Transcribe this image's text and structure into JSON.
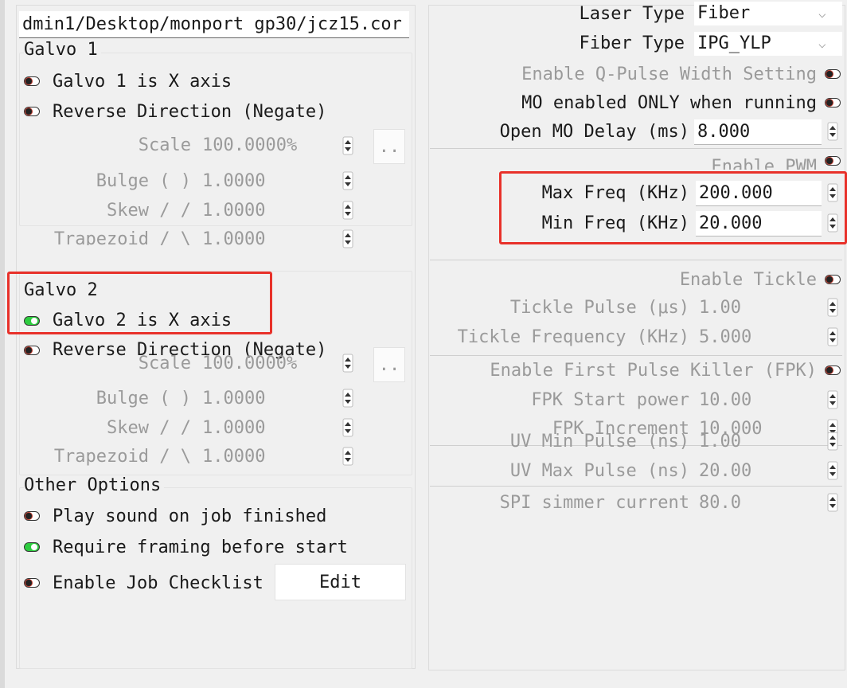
{
  "path_field": {
    "value": "dmin1/Desktop/monport gp30/jcz15.cor"
  },
  "galvo1": {
    "title": "Galvo 1",
    "x_axis": {
      "label": "Galvo 1 is X axis",
      "state": "off"
    },
    "reverse": {
      "label": "Reverse Direction (Negate)",
      "state": "off"
    },
    "scale": {
      "label": "Scale",
      "value": "100.0000%",
      "button": ".."
    },
    "bulge": {
      "label": "Bulge ( )",
      "value": "1.0000"
    },
    "skew": {
      "label": "Skew / /",
      "value": "1.0000"
    },
    "trapezoid": {
      "label": "Trapezoid / \\",
      "value": "1.0000"
    }
  },
  "galvo2": {
    "title": "Galvo 2",
    "x_axis": {
      "label": "Galvo 2 is X axis",
      "state": "on"
    },
    "reverse": {
      "label": "Reverse Direction (Negate)",
      "state": "off"
    },
    "scale": {
      "label": "Scale",
      "value": "100.0000%",
      "button": ".."
    },
    "bulge": {
      "label": "Bulge ( )",
      "value": "1.0000"
    },
    "skew": {
      "label": "Skew / /",
      "value": "1.0000"
    },
    "trapezoid": {
      "label": "Trapezoid / \\",
      "value": "1.0000"
    }
  },
  "other": {
    "title": "Other Options",
    "play_sound": {
      "label": "Play sound on job finished",
      "state": "off"
    },
    "require_framing": {
      "label": "Require framing before start",
      "state": "on"
    },
    "job_checklist": {
      "label": "Enable Job Checklist",
      "state": "off"
    },
    "edit_button": "Edit"
  },
  "laser": {
    "laser_type": {
      "label": "Laser Type",
      "value": "Fiber"
    },
    "fiber_type": {
      "label": "Fiber Type",
      "value": "IPG_YLP"
    },
    "q_pulse": {
      "label": "Enable Q-Pulse Width Setting",
      "state": "off"
    },
    "mo_running": {
      "label": "MO enabled ONLY when running",
      "state": "off"
    },
    "mo_delay": {
      "label": "Open MO Delay (ms)",
      "value": "8.000"
    },
    "pwm": {
      "label": "Enable PWM",
      "state": "off"
    },
    "max_freq": {
      "label": "Max Freq (KHz)",
      "value": "200.000"
    },
    "min_freq": {
      "label": "Min Freq (KHz)",
      "value": "20.000"
    },
    "tickle": {
      "label": "Enable Tickle",
      "state": "off"
    },
    "tickle_pulse": {
      "label": "Tickle Pulse (μs)",
      "value": "1.00"
    },
    "tickle_freq": {
      "label": "Tickle Frequency (KHz)",
      "value": "5.000"
    },
    "fpk": {
      "label": "Enable First Pulse Killer (FPK)",
      "state": "off"
    },
    "fpk_start": {
      "label": "FPK Start power",
      "value": "10.00"
    },
    "fpk_inc": {
      "label": "FPK Increment",
      "value": "10.000"
    },
    "uv_min": {
      "label": "UV Min Pulse (ns)",
      "value": "1.00"
    },
    "uv_max": {
      "label": "UV Max Pulse (ns)",
      "value": "20.00"
    },
    "spi": {
      "label": "SPI simmer current",
      "value": "80.0"
    }
  },
  "colors": {
    "toggle_off": "#c0392b",
    "toggle_on": "#2ecc40",
    "highlight": "#e8312a"
  },
  "icons": {
    "toggle": "toggle-switch-icon",
    "spin": "spin-arrows-icon",
    "combo": "chevron-down-icon"
  }
}
